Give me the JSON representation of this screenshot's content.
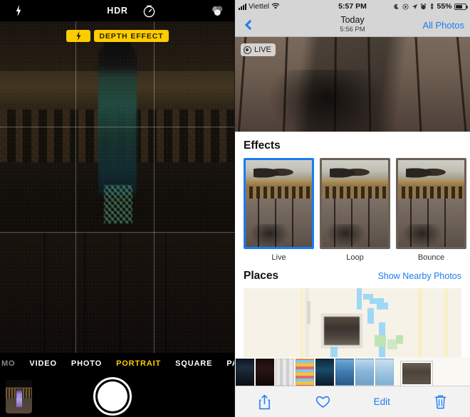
{
  "camera": {
    "topbar": {
      "flash_icon": "flash-bolt-icon",
      "hdr_label": "HDR",
      "timer_icon": "timer-icon",
      "filters_icon": "filters-icon"
    },
    "badges": {
      "flash_icon": "flash-bolt-icon",
      "depth_effect_label": "DEPTH EFFECT",
      "badge_color": "#ffcc00"
    },
    "modes": [
      {
        "label": "MO",
        "active": false,
        "partial": true
      },
      {
        "label": "VIDEO",
        "active": false,
        "partial": false
      },
      {
        "label": "PHOTO",
        "active": false,
        "partial": false
      },
      {
        "label": "PORTRAIT",
        "active": true,
        "partial": false
      },
      {
        "label": "SQUARE",
        "active": false,
        "partial": false
      },
      {
        "label": "PANO",
        "active": false,
        "partial": false
      }
    ],
    "active_mode_color": "#ffcc00",
    "shutter_name": "shutter-button",
    "thumbnail_name": "last-photo-thumbnail",
    "grid_enabled": true
  },
  "photos": {
    "statusbar": {
      "carrier": "Viettel",
      "wifi_icon": "wifi-icon",
      "time": "5:57 PM",
      "do_not_disturb_icon": "moon-icon",
      "target_icon": "target-icon",
      "location_icon": "location-arrow-icon",
      "alarm_icon": "alarm-clock-icon",
      "bluetooth_icon": "bluetooth-icon",
      "battery_percent": "55%",
      "battery_icon": "battery-icon"
    },
    "navbar": {
      "back_icon": "chevron-left-icon",
      "title": "Today",
      "subtitle": "5:56 PM",
      "right_label": "All Photos",
      "accent_color": "#1d7bf2"
    },
    "hero": {
      "live_badge_label": "LIVE",
      "live_badge_icon": "live-photo-icon"
    },
    "effects": {
      "title": "Effects",
      "items": [
        {
          "label": "Live",
          "selected": true
        },
        {
          "label": "Loop",
          "selected": false
        },
        {
          "label": "Bounce",
          "selected": false
        },
        {
          "label": "",
          "selected": false
        }
      ],
      "selection_color": "#1a7cf0"
    },
    "places": {
      "title": "Places",
      "action_label": "Show Nearby Photos"
    },
    "toolbar": {
      "share_icon": "share-icon",
      "favorite_icon": "heart-icon",
      "edit_label": "Edit",
      "delete_icon": "trash-icon"
    }
  }
}
